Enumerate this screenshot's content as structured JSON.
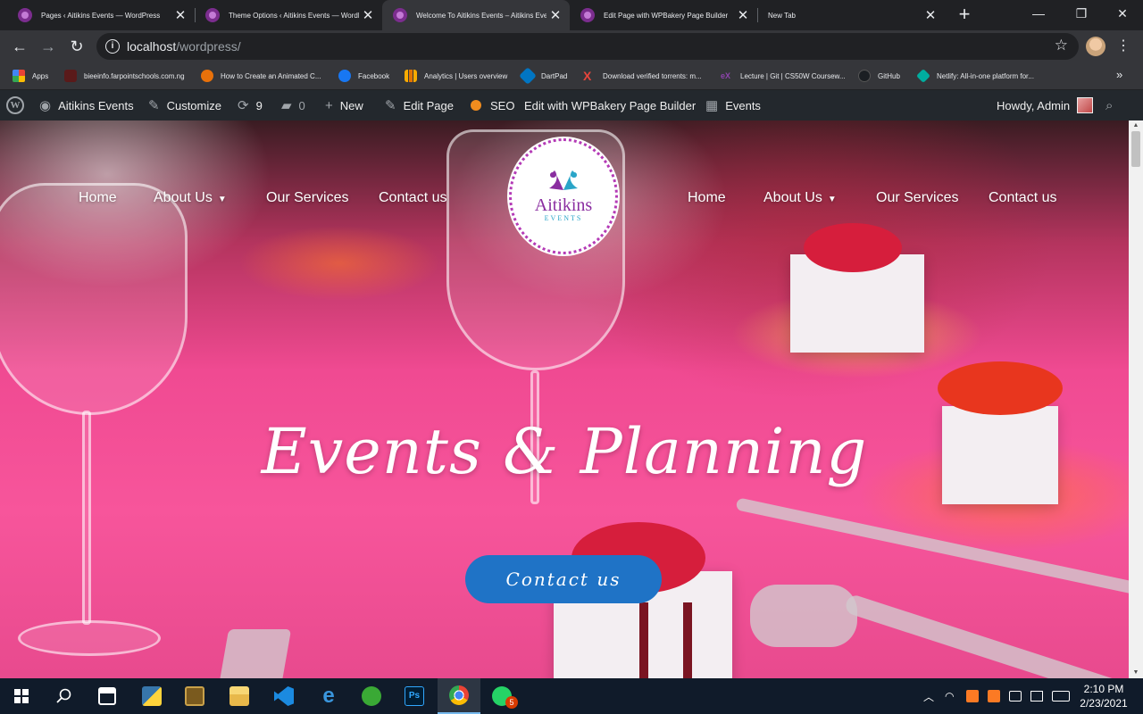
{
  "browser": {
    "tabs": [
      {
        "title": "Pages ‹ Aitikins Events — WordPress",
        "active": false
      },
      {
        "title": "Theme Options ‹ Aitikins Events — WordPress",
        "active": false
      },
      {
        "title": "Welcome To Aitikins Events – Aitikins Events",
        "active": true
      },
      {
        "title": "Edit Page with WPBakery Page Builder",
        "active": false
      },
      {
        "title": "New Tab",
        "active": false
      }
    ],
    "new_tab_icon": "+",
    "url_host": "localhost",
    "url_path": "/wordpress/",
    "bookmarks": [
      {
        "label": "Apps",
        "icon": "apps-grid-icon",
        "color": "#ea4335"
      },
      {
        "label": "bieeinfo.farpointschools.com.ng",
        "icon": "site-icon",
        "color": "#c5221f"
      },
      {
        "label": "How to Create an Animated C...",
        "icon": "site-icon",
        "color": "#e8710a"
      },
      {
        "label": "Facebook",
        "icon": "facebook-icon",
        "color": "#1877f2"
      },
      {
        "label": "Analytics | Users overview",
        "icon": "analytics-icon",
        "color": "#f9ab00"
      },
      {
        "label": "DartPad",
        "icon": "dart-icon",
        "color": "#0175c2"
      },
      {
        "label": "Download verified torrents: m...",
        "icon": "x-icon",
        "color": "#e8453c"
      },
      {
        "label": "Lecture | Git | CS50W Coursew...",
        "icon": "edx-icon",
        "color": "#8e44ad"
      },
      {
        "label": "GitHub",
        "icon": "github-icon",
        "color": "#24292e"
      },
      {
        "label": "Netlify: All-in-one platform for...",
        "icon": "netlify-icon",
        "color": "#00ad9f"
      }
    ]
  },
  "adminbar": {
    "site_name": "Aitikins Events",
    "customize": "Customize",
    "updates_count": "9",
    "comments_count": "0",
    "new": "New",
    "edit_page": "Edit Page",
    "seo": "SEO",
    "wpbakery": "Edit with WPBakery Page Builder",
    "events": "Events",
    "howdy": "Howdy, Admin"
  },
  "site": {
    "nav_left": [
      {
        "label": "Home",
        "has_dropdown": false
      },
      {
        "label": "About Us",
        "has_dropdown": true
      },
      {
        "label": "Our Services",
        "has_dropdown": false
      },
      {
        "label": "Contact us",
        "has_dropdown": false
      }
    ],
    "nav_right": [
      {
        "label": "Home",
        "has_dropdown": false
      },
      {
        "label": "About Us",
        "has_dropdown": true
      },
      {
        "label": "Our Services",
        "has_dropdown": false
      },
      {
        "label": "Contact us",
        "has_dropdown": false
      }
    ],
    "logo_name": "Aitikins",
    "logo_sub": "EVENTS",
    "hero_title": "Events & Planning",
    "cta_label": "Contact us",
    "colors": {
      "accent": "#1f73c6",
      "logo_purple": "#8a2da0",
      "logo_teal": "#2aa5c8"
    }
  },
  "taskbar": {
    "whatsapp_badge": "5",
    "time": "2:10 PM",
    "date": "2/23/2021"
  }
}
